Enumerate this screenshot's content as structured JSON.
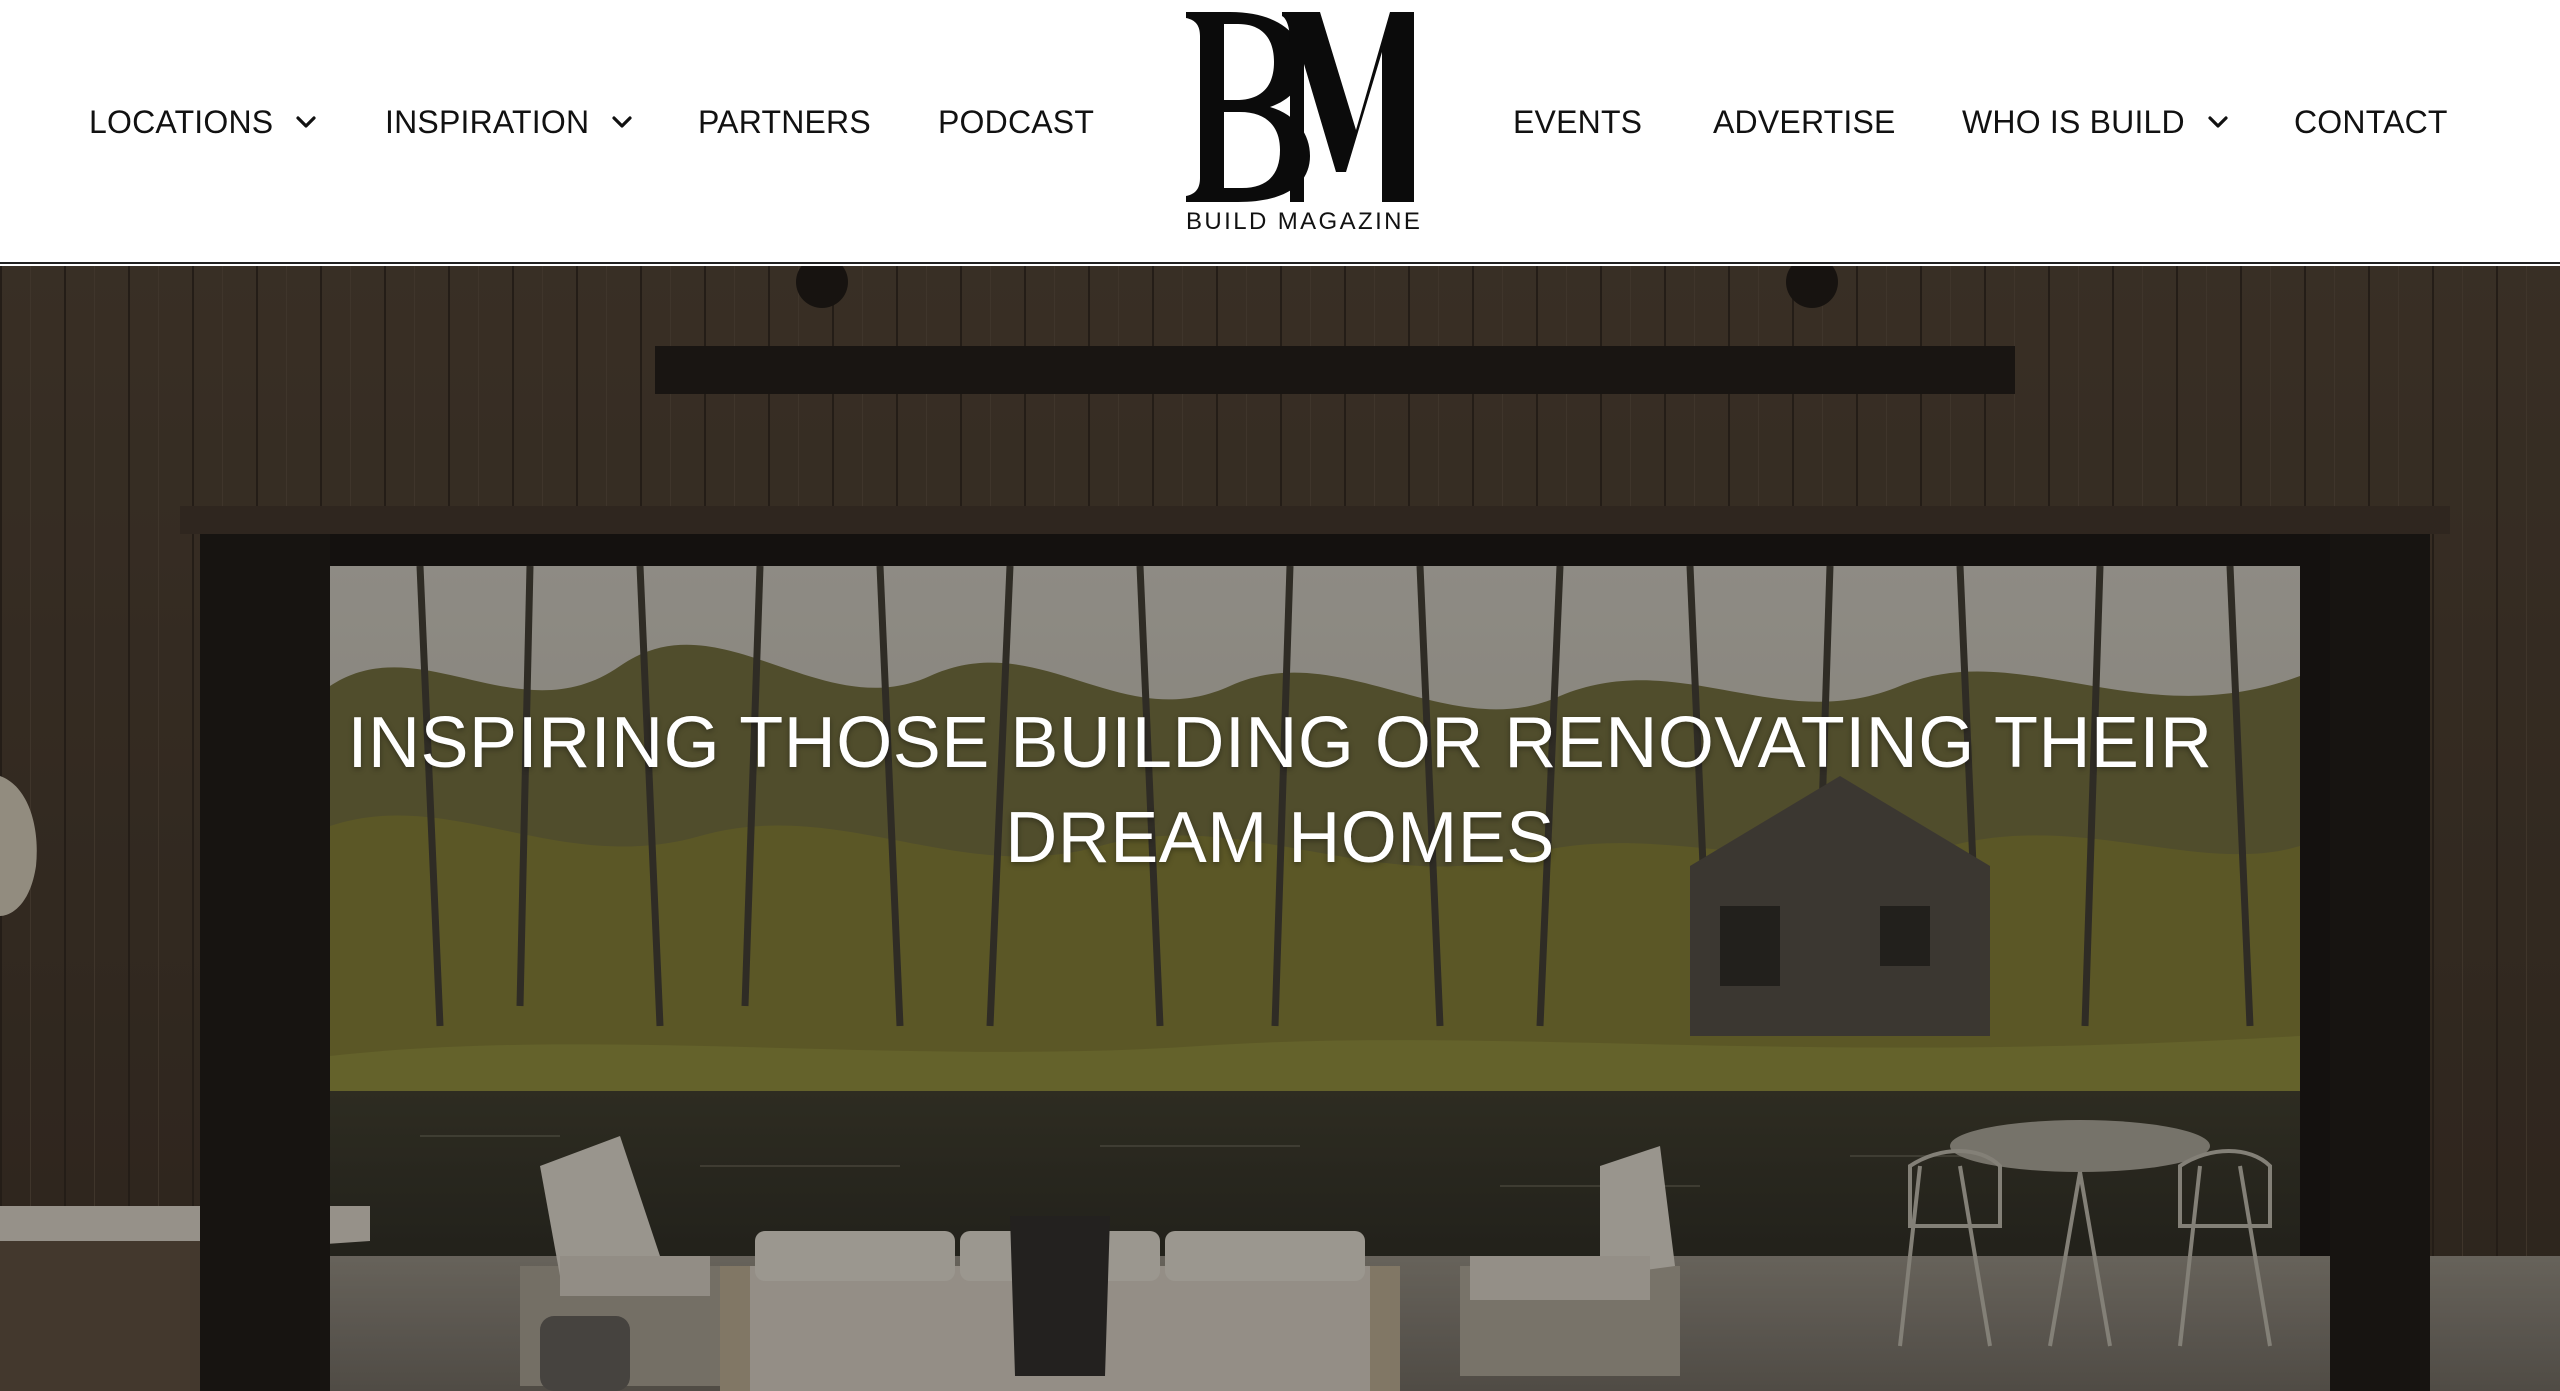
{
  "nav": {
    "left": [
      {
        "label": "LOCATIONS",
        "has_dropdown": true
      },
      {
        "label": "INSPIRATION",
        "has_dropdown": true
      },
      {
        "label": "PARTNERS",
        "has_dropdown": false
      },
      {
        "label": "PODCAST",
        "has_dropdown": false
      }
    ],
    "right": [
      {
        "label": "EVENTS",
        "has_dropdown": false
      },
      {
        "label": "ADVERTISE",
        "has_dropdown": false
      },
      {
        "label": "WHO IS BUILD",
        "has_dropdown": true
      },
      {
        "label": "CONTACT",
        "has_dropdown": false
      }
    ],
    "dropdown_icon": "chevron-down-icon"
  },
  "logo": {
    "monogram": "BM",
    "name": "BUILD MAGAZINE"
  },
  "hero": {
    "headline": "INSPIRING THOSE BUILDING OR RENOVATING THEIR DREAM HOMES",
    "image_subject": "open wooden pavilion overlooking a pond, trees and a cabin with outdoor sofa, armchairs and dining table"
  },
  "colors": {
    "header_bg": "#ffffff",
    "nav_text": "#111111",
    "hero_text": "#ffffff",
    "wood": "#4a3d30"
  }
}
